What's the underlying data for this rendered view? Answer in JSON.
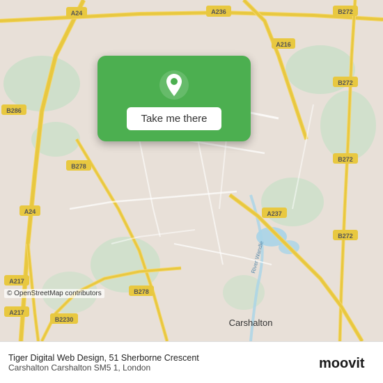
{
  "map": {
    "background_color": "#e8e0d8",
    "popup": {
      "bg_color": "#4caf50",
      "pin_color": "white",
      "button_label": "Take me there",
      "button_bg": "white",
      "button_text_color": "#333"
    },
    "copyright": "© OpenStreetMap contributors"
  },
  "bottom_bar": {
    "business_name": "Tiger Digital Web Design, 51 Sherborne Crescent",
    "address": "Carshalton Carshalton SM5 1, London",
    "logo_text": "moovit"
  },
  "road_labels": [
    "A236",
    "A216",
    "B272",
    "B272",
    "B272",
    "B272",
    "A24",
    "B286",
    "A24",
    "B278",
    "B278",
    "A217",
    "A217",
    "B2230",
    "A237"
  ]
}
